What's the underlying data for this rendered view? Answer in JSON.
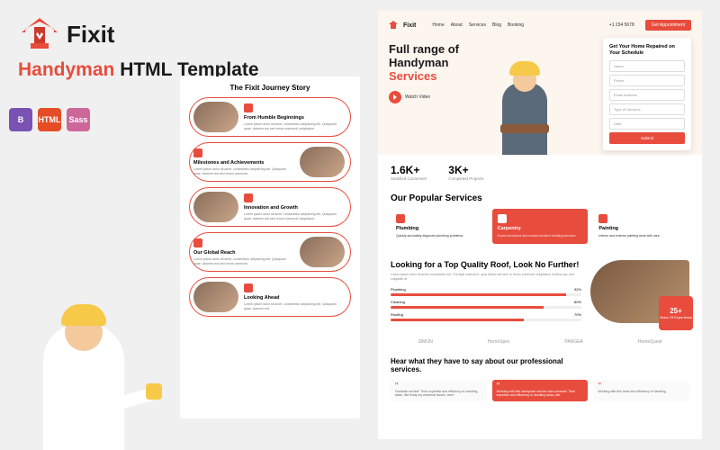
{
  "brand": {
    "name": "Fixit"
  },
  "headline": {
    "prefix": "Handyman",
    "suffix": " HTML Template"
  },
  "tech_badges": [
    {
      "id": "bootstrap",
      "glyph": "B"
    },
    {
      "id": "html",
      "glyph": "HTML"
    },
    {
      "id": "sass",
      "glyph": "Sass"
    }
  ],
  "story": {
    "title": "The Fixit Journey Story",
    "items": [
      {
        "heading": "From Humble Beginnings",
        "body": "Lorem ipsum dolor sit amet, consectetur adipisicing elit. Quisquam quae, dolorem est sed rerum commodi voluptatum."
      },
      {
        "heading": "Milestones and Achievements",
        "body": "Lorem ipsum dolor sit amet, consectetur adipisicing elit. Quisquam quae, dolorem est sed rerum commodi."
      },
      {
        "heading": "Innovation and Growth",
        "body": "Lorem ipsum dolor sit amet, consectetur adipisicing elit. Quisquam quae, dolorem est sed rerum commodi voluptatum."
      },
      {
        "heading": "Our Global Reach",
        "body": "Lorem ipsum dolor sit amet, consectetur adipisicing elit. Quisquam quae, dolorem est sed rerum commodi."
      },
      {
        "heading": "Looking Ahead",
        "body": "Lorem ipsum dolor sit amet, consectetur adipisicing elit. Quisquam quae, dolorem est."
      }
    ]
  },
  "nav": {
    "links": [
      "Home",
      "About",
      "Services",
      "Blog",
      "Booking"
    ],
    "phone": "+1 234 5678",
    "cta": "Get Appointment"
  },
  "hero": {
    "title_l1": "Full range of",
    "title_l2": "Handyman",
    "title_l3": "Services",
    "play_label": "Watch Video",
    "form": {
      "title": "Get Your Home Repaired on Your Schedule",
      "fields": [
        "Name",
        "Phone",
        "Email Address",
        "Type of Services",
        "Date"
      ],
      "submit": "Submit"
    }
  },
  "stats": [
    {
      "n": "1.6K+",
      "l": "Satisfied Customers"
    },
    {
      "n": "3K+",
      "l": "Completed Projects"
    }
  ],
  "services": {
    "title": "Our Popular Services",
    "cards": [
      {
        "name": "Plumbing",
        "desc": "Quickly accurately diagnose plumbing problems."
      },
      {
        "name": "Carpentry",
        "desc": "Expert woodwork and custom furniture building services."
      },
      {
        "name": "Painting",
        "desc": "Interior and exterior painting done with care."
      }
    ]
  },
  "roof": {
    "title": "Looking for a Top Quality Roof, Look No Further!",
    "desc": "Lorem ipsum dolor sit amet consectetur elit. The legit nostrud in, quia dolore est sed. In rerum commodi voluptatum minima aut, sed voluptate at.",
    "bars": [
      {
        "label": "Plumbing",
        "pct": 92
      },
      {
        "label": "Cleaning",
        "pct": 80
      },
      {
        "label": "Roofing",
        "pct": 70
      }
    ],
    "badge": {
      "n": "25+",
      "l": "Years Of Experience"
    }
  },
  "brands": [
    "SIMON",
    "HomeSpec",
    "PANGEA",
    "HomeQuest"
  ],
  "testimonials": {
    "title": "Hear what they have to say about our professional services.",
    "cards": [
      {
        "text": "Fantastic service! Their expertise and efficiency in handling tasks, like fixing my electrical issues, were"
      },
      {
        "text": "Working with this handyman service was a breeze! Their expertise and efficiency in handling tasks, like"
      },
      {
        "text": "Working with this hand and efficiency in handling"
      }
    ]
  }
}
